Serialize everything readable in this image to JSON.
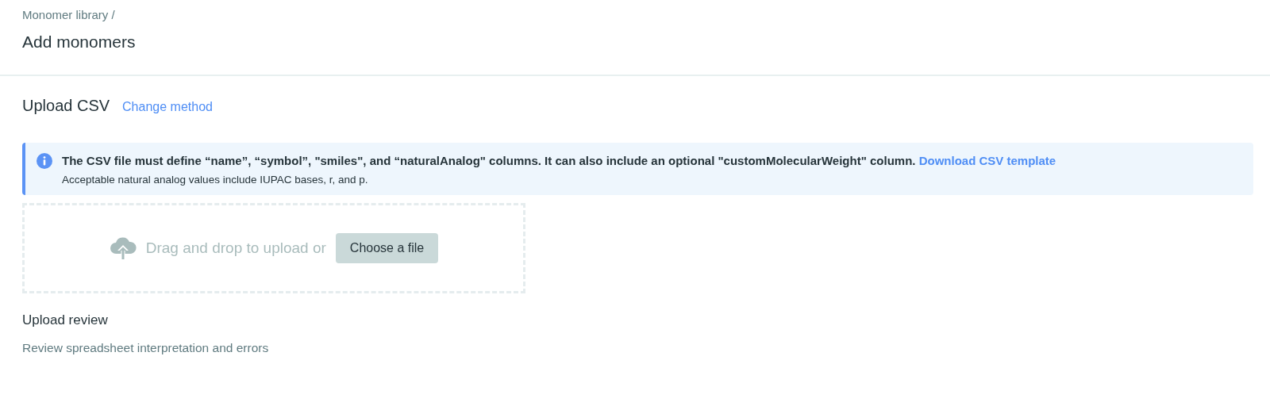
{
  "breadcrumb": "Monomer library /",
  "title": "Add monomers",
  "section": {
    "title": "Upload CSV",
    "link": "Change method"
  },
  "info": {
    "message": "The CSV file must define “name”, “symbol”, \"smiles\", and “naturalAnalog\" columns. It can also include an optional \"customMolecularWeight\" column.",
    "link": "Download CSV template",
    "note": "Acceptable natural analog values include IUPAC bases, r, and p."
  },
  "dropzone": {
    "text": "Drag and drop to upload or",
    "button": "Choose a file"
  },
  "review": {
    "title": "Upload review",
    "subtitle": "Review spreadsheet interpretation and errors"
  }
}
